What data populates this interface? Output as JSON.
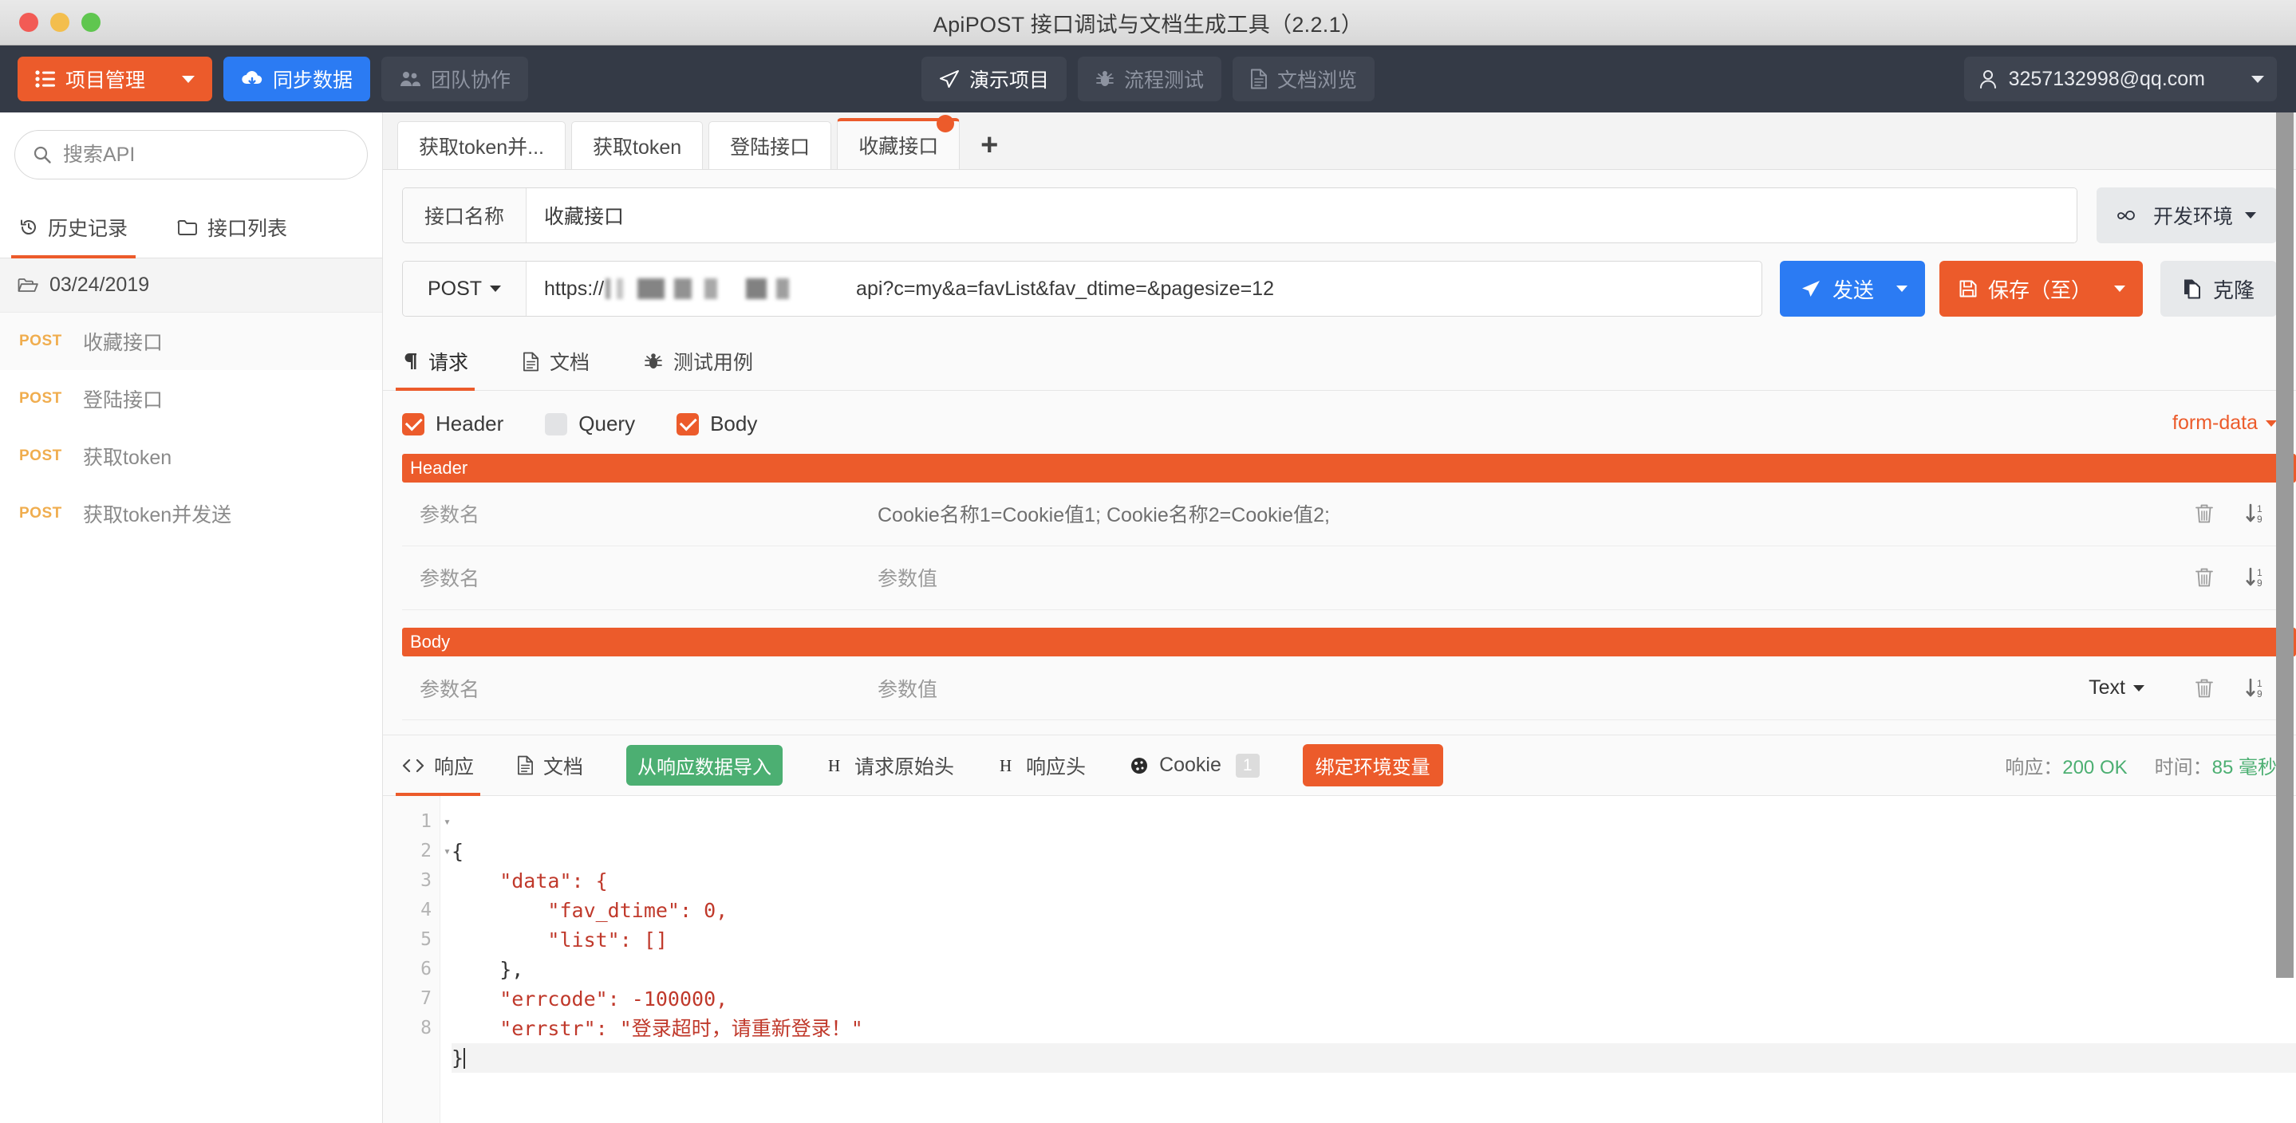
{
  "window": {
    "title": "ApiPOST 接口调试与文档生成工具（2.2.1）"
  },
  "toolbar": {
    "project_manage": "项目管理",
    "sync_data": "同步数据",
    "team_collab": "团队协作",
    "demo_project": "演示项目",
    "flow_test": "流程测试",
    "doc_browse": "文档浏览",
    "user_email": "3257132998@qq.com"
  },
  "sidebar": {
    "search_placeholder": "搜索API",
    "tabs": [
      {
        "label": "历史记录",
        "icon": "history-icon",
        "active": true
      },
      {
        "label": "接口列表",
        "icon": "folder-icon",
        "active": false
      }
    ],
    "folder": "03/24/2019",
    "items": [
      {
        "method": "POST",
        "label": "收藏接口",
        "selected": true
      },
      {
        "method": "POST",
        "label": "登陆接口",
        "selected": false
      },
      {
        "method": "POST",
        "label": "获取token",
        "selected": false
      },
      {
        "method": "POST",
        "label": "获取token并发送",
        "selected": false
      }
    ]
  },
  "doc_tabs": [
    {
      "label": "获取token并...",
      "active": false,
      "dirty": false
    },
    {
      "label": "获取token",
      "active": false,
      "dirty": false
    },
    {
      "label": "登陆接口",
      "active": false,
      "dirty": false
    },
    {
      "label": "收藏接口",
      "active": true,
      "dirty": true
    }
  ],
  "tab_add": "+",
  "request": {
    "name_label": "接口名称",
    "name_value": "收藏接口",
    "env_label": "开发环境",
    "method": "POST",
    "url_prefix": "https://",
    "url_suffix": "api?c=my&a=favList&fav_dtime=&pagesize=12",
    "send_label": "发送",
    "save_label": "保存（至）",
    "clone_label": "克隆",
    "sub_tabs": [
      {
        "label": "请求",
        "icon": "paragraph-icon",
        "active": true
      },
      {
        "label": "文档",
        "icon": "document-icon",
        "active": false
      },
      {
        "label": "测试用例",
        "icon": "bug-icon",
        "active": false
      }
    ],
    "checks": [
      {
        "label": "Header",
        "checked": true
      },
      {
        "label": "Query",
        "checked": false
      },
      {
        "label": "Body",
        "checked": true
      }
    ],
    "body_type": "form-data",
    "sections": [
      {
        "badge": "Header",
        "rows": [
          {
            "key_placeholder": "参数名",
            "value": "Cookie名称1=Cookie值1; Cookie名称2=Cookie值2;",
            "value_filled": true,
            "type": null
          },
          {
            "key_placeholder": "参数名",
            "value": "参数值",
            "value_filled": false,
            "type": null
          }
        ]
      },
      {
        "badge": "Body",
        "rows": [
          {
            "key_placeholder": "参数名",
            "value": "参数值",
            "value_filled": false,
            "type": "Text"
          }
        ]
      }
    ]
  },
  "response": {
    "tabs": [
      {
        "label": "响应",
        "icon": "code-icon",
        "active": true,
        "badge": null
      },
      {
        "label": "文档",
        "icon": "document-icon",
        "active": false,
        "badge": null
      },
      {
        "label": "请求原始头",
        "icon": "h-icon",
        "active": false,
        "badge": null
      },
      {
        "label": "响应头",
        "icon": "h-icon",
        "active": false,
        "badge": null
      },
      {
        "label": "Cookie",
        "icon": "cookie-icon",
        "active": false,
        "badge": "1"
      }
    ],
    "import_btn": "从响应数据导入",
    "bind_env_btn": "绑定环境变量",
    "status_label": "响应：",
    "status_value": "200 OK",
    "time_label": "时间：",
    "time_value": "85 毫秒",
    "code_lines": [
      {
        "n": "1",
        "fold": true,
        "html": "{"
      },
      {
        "n": "2",
        "fold": true,
        "html": "    \"data\": {"
      },
      {
        "n": "3",
        "fold": false,
        "html": "        \"fav_dtime\": 0,"
      },
      {
        "n": "4",
        "fold": false,
        "html": "        \"list\": []"
      },
      {
        "n": "5",
        "fold": false,
        "html": "    },"
      },
      {
        "n": "6",
        "fold": false,
        "html": "    \"errcode\": -100000,"
      },
      {
        "n": "7",
        "fold": false,
        "html": "    \"errstr\": \"登录超时，请重新登录！\""
      },
      {
        "n": "8",
        "fold": false,
        "html": "}"
      }
    ]
  },
  "colors": {
    "accent_orange": "#ec5b2b",
    "accent_blue": "#2b7bf3",
    "toolbar_dark": "#343a46",
    "green": "#4caf72"
  }
}
